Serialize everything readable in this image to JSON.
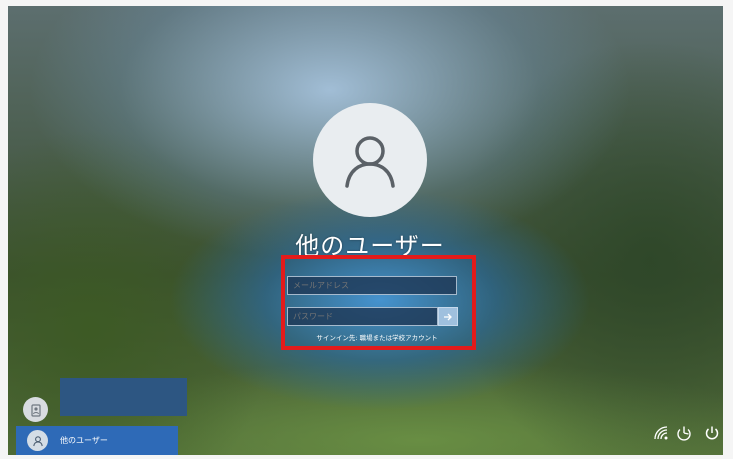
{
  "login": {
    "user_name": "他のユーザー",
    "email_placeholder": "メールアドレス",
    "password_placeholder": "パスワード",
    "signin_options": "サインイン先: 職場または学校アカウント"
  },
  "account_list": {
    "selected_label": "他のユーザー"
  },
  "icons": {
    "avatar": "person-icon",
    "submit": "arrow-right-icon",
    "account": "id-badge-icon",
    "network": "network-icon",
    "accessibility": "ease-of-access-icon",
    "power": "power-icon"
  },
  "colors": {
    "highlight": "#e31b1b",
    "selected_item": "#2e6ab7",
    "submit_button": "#9fc0de"
  }
}
